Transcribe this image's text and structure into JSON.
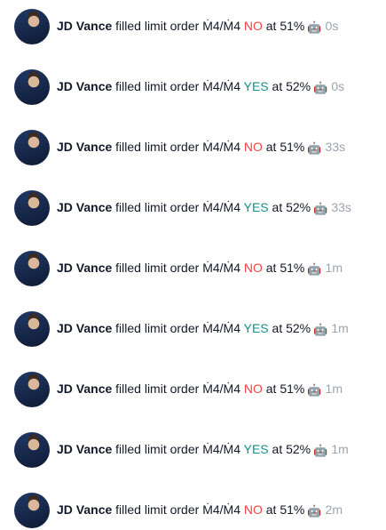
{
  "feed": {
    "rows": [
      {
        "user": "JD Vance",
        "action": "filled limit order",
        "amount": "Ṁ4/Ṁ4",
        "outcome": "NO",
        "prob_text": "at 51%",
        "bot_icon": "robot-icon",
        "time": "0s"
      },
      {
        "user": "JD Vance",
        "action": "filled limit order",
        "amount": "Ṁ4/Ṁ4",
        "outcome": "YES",
        "prob_text": "at 52%",
        "bot_icon": "robot-icon",
        "time": "0s"
      },
      {
        "user": "JD Vance",
        "action": "filled limit order",
        "amount": "Ṁ4/Ṁ4",
        "outcome": "NO",
        "prob_text": "at 51%",
        "bot_icon": "robot-icon",
        "time": "33s"
      },
      {
        "user": "JD Vance",
        "action": "filled limit order",
        "amount": "Ṁ4/Ṁ4",
        "outcome": "YES",
        "prob_text": "at 52%",
        "bot_icon": "robot-icon",
        "time": "33s"
      },
      {
        "user": "JD Vance",
        "action": "filled limit order",
        "amount": "Ṁ4/Ṁ4",
        "outcome": "NO",
        "prob_text": "at 51%",
        "bot_icon": "robot-icon",
        "time": "1m"
      },
      {
        "user": "JD Vance",
        "action": "filled limit order",
        "amount": "Ṁ4/Ṁ4",
        "outcome": "YES",
        "prob_text": "at 52%",
        "bot_icon": "robot-icon",
        "time": "1m"
      },
      {
        "user": "JD Vance",
        "action": "filled limit order",
        "amount": "Ṁ4/Ṁ4",
        "outcome": "NO",
        "prob_text": "at 51%",
        "bot_icon": "robot-icon",
        "time": "1m"
      },
      {
        "user": "JD Vance",
        "action": "filled limit order",
        "amount": "Ṁ4/Ṁ4",
        "outcome": "YES",
        "prob_text": "at 52%",
        "bot_icon": "robot-icon",
        "time": "1m"
      },
      {
        "user": "JD Vance",
        "action": "filled limit order",
        "amount": "Ṁ4/Ṁ4",
        "outcome": "NO",
        "prob_text": "at 51%",
        "bot_icon": "robot-icon",
        "time": "2m"
      }
    ]
  },
  "colors": {
    "no": "#ef4444",
    "yes": "#0f9488",
    "time": "#9ca3af",
    "text": "#111827"
  }
}
